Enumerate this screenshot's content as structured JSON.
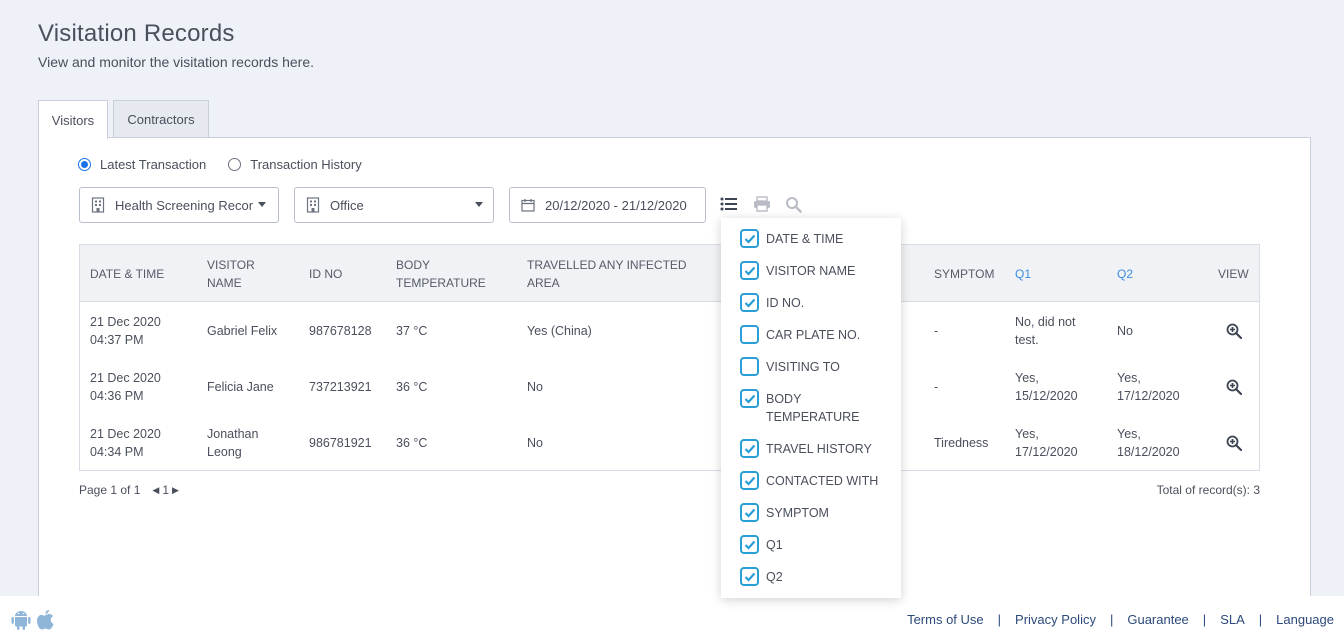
{
  "header": {
    "title": "Visitation Records",
    "subtitle": "View and monitor the visitation records here."
  },
  "tabs": [
    {
      "label": "Visitors",
      "active": true
    },
    {
      "label": "Contractors",
      "active": false
    }
  ],
  "filters": {
    "radio_options": [
      {
        "label": "Latest Transaction",
        "checked": true
      },
      {
        "label": "Transaction History",
        "checked": false
      }
    ],
    "record_type_select": "Health Screening Recor",
    "location_select": "Office",
    "date_range": "20/12/2020 - 21/12/2020"
  },
  "table": {
    "headers": {
      "date_time": "DATE & TIME",
      "visitor_name_1": "VISITOR",
      "visitor_name_2": "NAME",
      "id_no": "ID NO",
      "body_temp_1": "BODY",
      "body_temp_2": "TEMPERATURE",
      "travelled_1": "TRAVELLED ANY INFECTED",
      "travelled_2": "AREA",
      "symptom": "SYMPTOM",
      "q1": "Q1",
      "q2": "Q2",
      "view": "VIEW"
    },
    "rows": [
      {
        "date": "21 Dec 2020",
        "time": "04:37 PM",
        "name1": "Gabriel Felix",
        "name2": "",
        "id": "987678128",
        "temp": "37 °C",
        "travelled": "Yes (China)",
        "symptom": "-",
        "q1a": "No, did not",
        "q1b": "test.",
        "q2a": "No",
        "q2b": ""
      },
      {
        "date": "21 Dec 2020",
        "time": "04:36 PM",
        "name1": "Felicia Jane",
        "name2": "",
        "id": "737213921",
        "temp": "36 °C",
        "travelled": "No",
        "symptom": "-",
        "q1a": "Yes,",
        "q1b": "15/12/2020",
        "q2a": "Yes,",
        "q2b": "17/12/2020"
      },
      {
        "date": "21 Dec 2020",
        "time": "04:34 PM",
        "name1": "Jonathan",
        "name2": "Leong",
        "id": "986781921",
        "temp": "36 °C",
        "travelled": "No",
        "symptom": "Tiredness",
        "q1a": "Yes,",
        "q1b": "17/12/2020",
        "q2a": "Yes,",
        "q2b": "18/12/2020"
      }
    ]
  },
  "pagination": {
    "page_text": "Page 1 of 1",
    "current_page": "1",
    "total_text": "Total of record(s): 3"
  },
  "column_picker": [
    {
      "label": "DATE & TIME",
      "checked": true
    },
    {
      "label": "VISITOR NAME",
      "checked": true
    },
    {
      "label": "ID NO.",
      "checked": true
    },
    {
      "label": "CAR PLATE NO.",
      "checked": false
    },
    {
      "label": "VISITING TO",
      "checked": false
    },
    {
      "label": "BODY TEMPERATURE",
      "checked": true
    },
    {
      "label": "TRAVEL HISTORY",
      "checked": true
    },
    {
      "label": "CONTACTED WITH",
      "checked": true
    },
    {
      "label": "SYMPTOM",
      "checked": true
    },
    {
      "label": "Q1",
      "checked": true
    },
    {
      "label": "Q2",
      "checked": true
    }
  ],
  "footer": {
    "links": [
      "Terms of Use",
      "Privacy Policy",
      "Guarantee",
      "SLA",
      "Language"
    ],
    "separator": "|"
  },
  "colors": {
    "accent": "#1a73e8",
    "checkbox": "#2a9fd6",
    "link": "#2c4a7a",
    "store_icon": "#8fb6d8"
  },
  "icons": [
    "building-icon",
    "calendar-icon",
    "list-icon",
    "print-icon",
    "search-icon",
    "zoom-in-icon",
    "android-icon",
    "apple-icon"
  ]
}
